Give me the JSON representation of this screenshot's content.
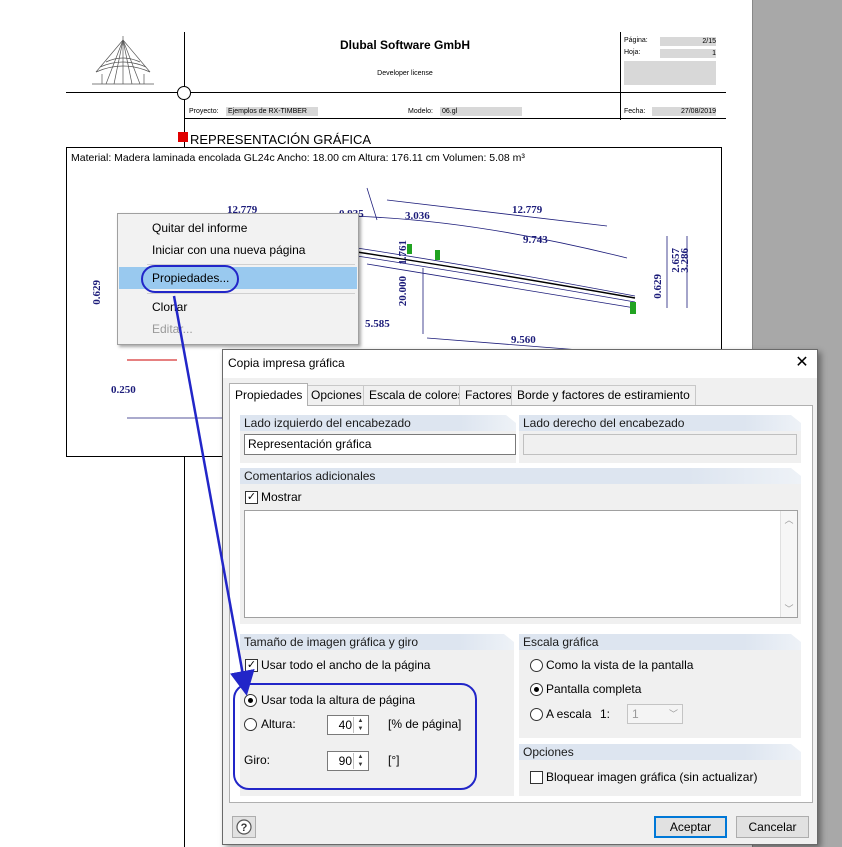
{
  "report": {
    "company": "Dlubal Software GmbH",
    "license": "Developer license",
    "page_label": "Página:",
    "page_value": "2/15",
    "sheet_label": "Hoja:",
    "sheet_value": "1",
    "project_label": "Proyecto:",
    "project_value": "Ejemplos de RX-TIMBER",
    "model_label": "Modelo:",
    "model_value": "06.gl",
    "date_label": "Fecha:",
    "date_value": "27/08/2019",
    "section_title": "REPRESENTACIÓN GRÁFICA",
    "material_line": "Material: Madera laminada encolada GL24c   Ancho: 18.00 cm   Altura: 176.11 cm   Volumen: 5.08 m³",
    "dimensions": [
      "12.779",
      "0.935",
      "3.036",
      "12.779",
      "9.743",
      "1.761",
      "20.000",
      "5.585",
      "9.560",
      "2.657",
      "3.286",
      "0.629",
      "0.629",
      "0.250"
    ]
  },
  "context_menu": {
    "items": [
      {
        "label": "Quitar del informe",
        "enabled": true
      },
      {
        "label": "Iniciar con una nueva página",
        "enabled": true
      },
      {
        "label": "Propiedades...",
        "enabled": true
      },
      {
        "label": "Clonar",
        "enabled": true
      },
      {
        "label": "Editar...",
        "enabled": false
      }
    ]
  },
  "dialog": {
    "title": "Copia impresa gráfica",
    "close_glyph": "✕",
    "tabs": [
      "Propiedades",
      "Opciones",
      "Escala de colores",
      "Factores",
      "Borde y factores de estiramiento"
    ],
    "active_tab": "Propiedades",
    "header_left_label": "Lado izquierdo del encabezado",
    "header_left_value": "Representación gráfica",
    "header_right_label": "Lado derecho del encabezado",
    "header_right_value": "",
    "comments_label": "Comentarios adicionales",
    "show_label": "Mostrar",
    "show_checked": true,
    "comments_text": "",
    "size_group_label": "Tamaño de imagen gráfica y giro",
    "use_full_width_label": "Usar todo el ancho de la página",
    "use_full_width_checked": true,
    "use_full_height_label": "Usar toda la altura de página",
    "height_label": "Altura:",
    "height_value": "40",
    "height_unit": "[% de página]",
    "rotation_label": "Giro:",
    "rotation_value": "90",
    "rotation_unit": "[°]",
    "size_mode": "full_height",
    "scale_group_label": "Escala gráfica",
    "scale_screen_label": "Como la vista de la pantalla",
    "scale_full_label": "Pantalla completa",
    "scale_custom_label": "A escala",
    "scale_ratio_prefix": "1:",
    "scale_ratio_value": "1",
    "scale_mode": "full_screen",
    "options_group_label": "Opciones",
    "lock_label": "Bloquear imagen gráfica (sin actualizar)",
    "lock_checked": false,
    "ok_label": "Aceptar",
    "cancel_label": "Cancelar"
  },
  "icons": {
    "help": "help-icon",
    "close": "close-icon"
  },
  "colors": {
    "annotation": "#2226c8",
    "menu_highlight": "#99c9ef",
    "dimension_text": "#1c1c7a"
  }
}
